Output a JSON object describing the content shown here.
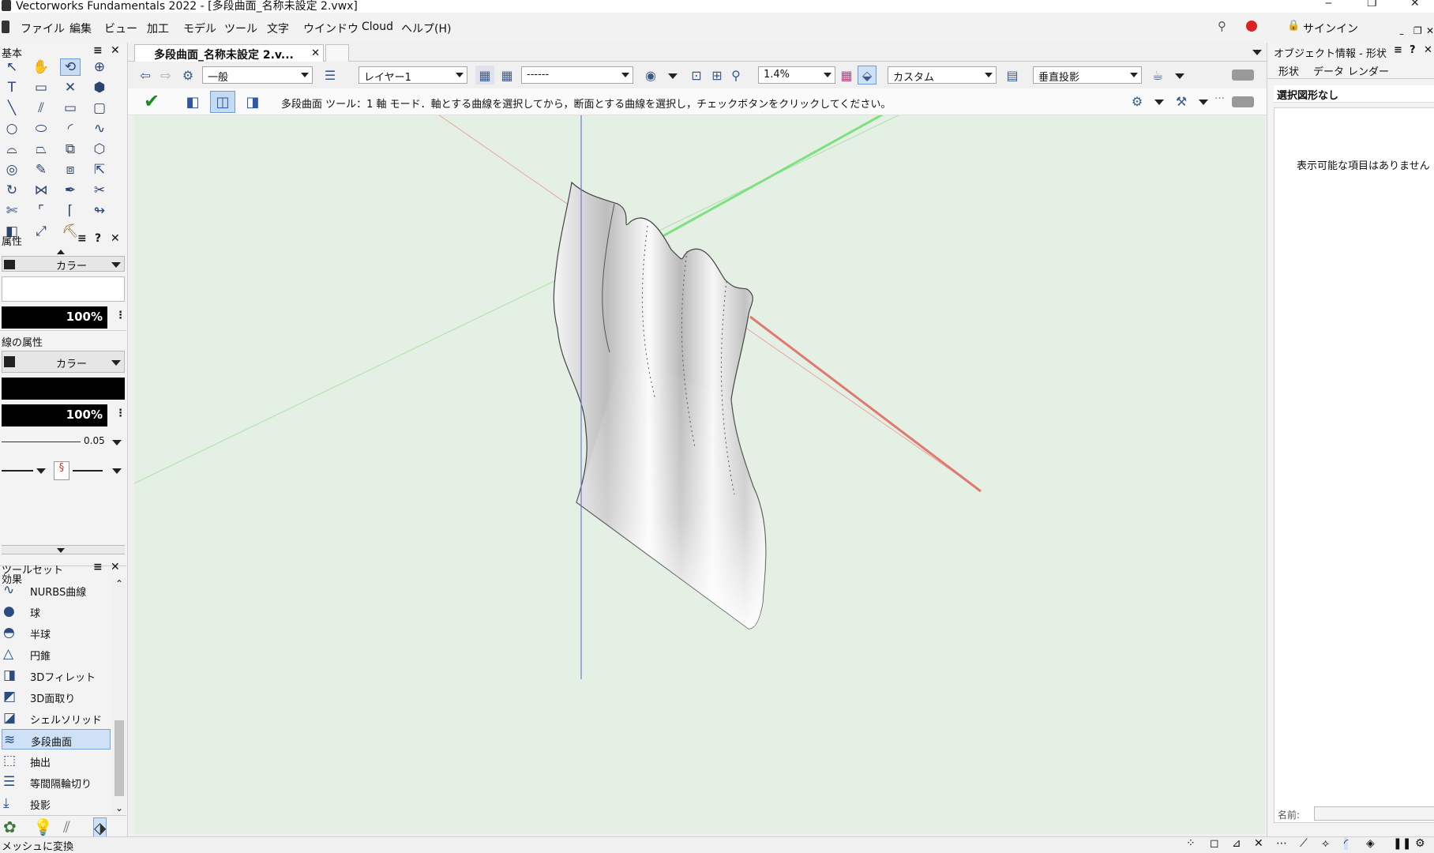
{
  "window": {
    "title": "Vectorworks Fundamentals 2022 - [多段曲面_名称未設定 2.vwx]",
    "min": "‒",
    "max": "❐",
    "close": "✕"
  },
  "menubar": {
    "items": [
      "ファイル",
      "編集",
      "ビュー",
      "加工",
      "モデル",
      "ツール",
      "文字",
      "ウインドウ",
      "Cloud",
      "ヘルプ(H)"
    ],
    "signin": "サインイン"
  },
  "left_palette": {
    "basic_title": "基本",
    "attributes_title": "属性",
    "fill_type": "カラー",
    "fill_opacity": "100%",
    "line_attributes_title": "線の属性",
    "line_type": "カラー",
    "line_opacity": "100%",
    "line_weight": "0.05",
    "effects_title": "効果",
    "toolset_title": "ツールセット",
    "toolset_items": [
      {
        "label": "NURBS曲線",
        "icon": "nurbs-curve-icon"
      },
      {
        "label": "球",
        "icon": "sphere-icon"
      },
      {
        "label": "半球",
        "icon": "hemisphere-icon"
      },
      {
        "label": "円錐",
        "icon": "cone-icon"
      },
      {
        "label": "3Dフィレット",
        "icon": "fillet-icon"
      },
      {
        "label": "3D面取り",
        "icon": "chamfer-icon"
      },
      {
        "label": "シェルソリッド",
        "icon": "shell-solid-icon"
      },
      {
        "label": "多段曲面",
        "icon": "loft-surface-icon",
        "selected": true
      },
      {
        "label": "抽出",
        "icon": "extract-icon"
      },
      {
        "label": "等間隔輪切り",
        "icon": "contour-icon"
      },
      {
        "label": "投影",
        "icon": "project-icon"
      }
    ]
  },
  "doc_tab": {
    "label": "多段曲面_名称未設定 2.v..."
  },
  "viewbar": {
    "class": "一般",
    "layer": "レイヤー1",
    "view_dropdown": "------",
    "zoom": "1.4%",
    "render_mode": "カスタム",
    "projection": "垂直投影"
  },
  "modebar": {
    "hint": "多段曲面 ツール：1 軸 モード．軸とする曲線を選択してから，断面とする曲線を選択し，チェックボタンをクリックしてください。"
  },
  "right_palette": {
    "title": "オブジェクト情報 - 形状",
    "tabs": [
      "形状",
      "データ",
      "レンダー"
    ],
    "selection": "選択図形なし",
    "empty_message": "表示可能な項目はありません",
    "name_label": "名前:"
  },
  "statusbar": {
    "text": "メッシュに変換"
  },
  "colors": {
    "canvas_bg": "#e5f0e4",
    "x_axis": "#e07a70",
    "y_axis": "#7fe07f",
    "z_axis": "#6e79d6",
    "accent": "#6e9ad6"
  }
}
